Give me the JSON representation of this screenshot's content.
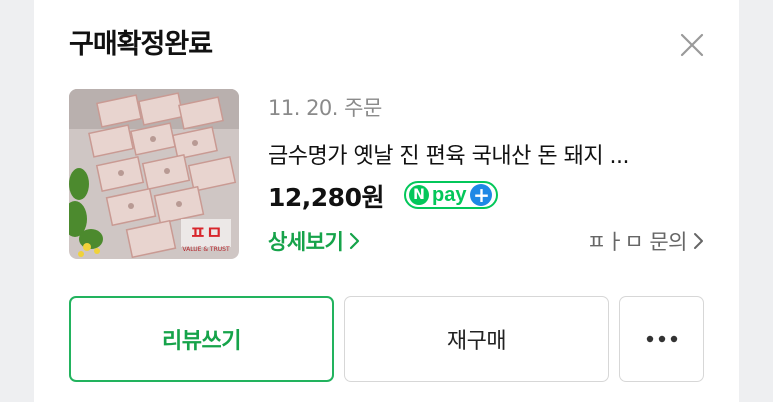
{
  "header": {
    "title": "구매확정완료"
  },
  "order": {
    "date": "11. 20. 주문",
    "product_name": "금수명가 옛날 진 편육 국내산 돈 돼지 ...",
    "price": "12,280원",
    "pay_badge": "pay",
    "detail_link": "상세보기",
    "seller_inquiry": "ㅍㅏㅁ 문의"
  },
  "thumbnail": {
    "logo_text": "ㅍㅁ",
    "logo_sub": "VALUE & TRUST"
  },
  "actions": {
    "review": "리뷰쓰기",
    "rebuy": "재구매"
  },
  "colors": {
    "accent_green": "#03c75a",
    "pay_plus_blue": "#1e88e5"
  },
  "icons": [
    "close-icon",
    "npay-n-icon",
    "npay-plus-icon",
    "chevron-right-icon",
    "more-dots-icon"
  ]
}
